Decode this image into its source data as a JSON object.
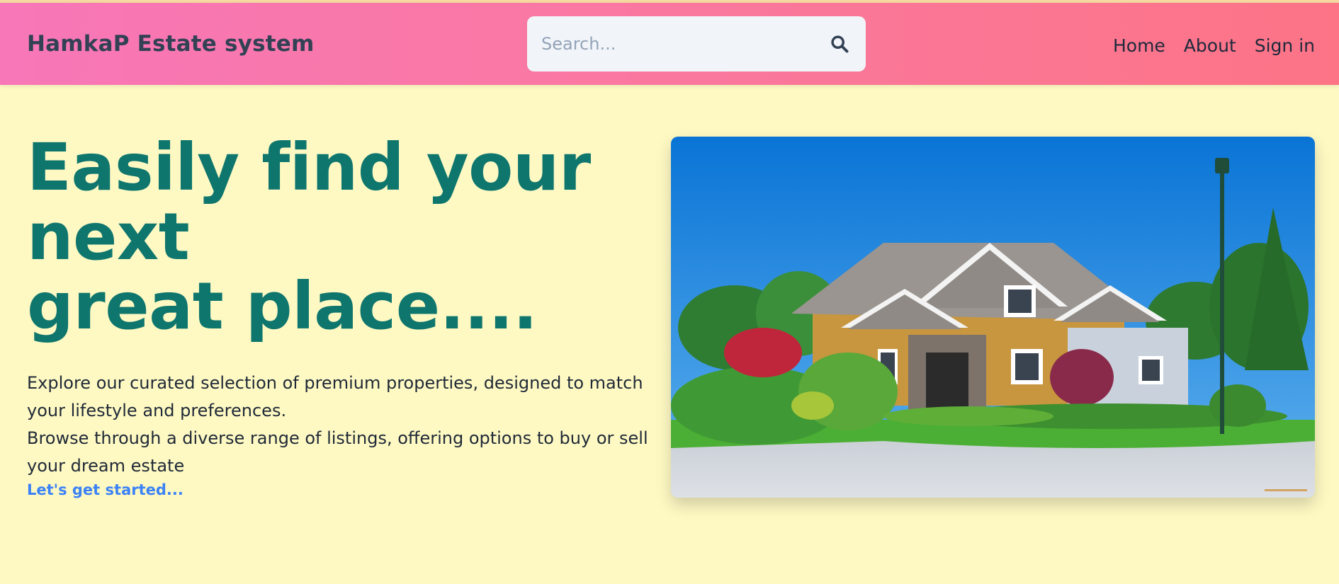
{
  "header": {
    "brand": "HamkaP Estate system",
    "search": {
      "placeholder": "Search...",
      "value": ""
    },
    "nav": [
      {
        "label": "Home"
      },
      {
        "label": "About"
      },
      {
        "label": "Sign in"
      }
    ]
  },
  "hero": {
    "title_lines": [
      "Easily find your",
      "next",
      "great place...."
    ],
    "description_lines": [
      "Explore our curated selection of premium properties, designed to match",
      "your lifestyle and preferences.",
      "Browse through a diverse range of listings, offering options to buy or sell",
      "your dream estate"
    ],
    "cta_label": "Let's get started..."
  },
  "icons": {
    "search_button": "search-icon"
  },
  "colors": {
    "background": "#fef9c3",
    "header_gradient": [
      "#f777b8",
      "#fc7486"
    ],
    "brand_text": "#334155",
    "hero_title": "#0f766e",
    "cta": "#3b82f6"
  }
}
